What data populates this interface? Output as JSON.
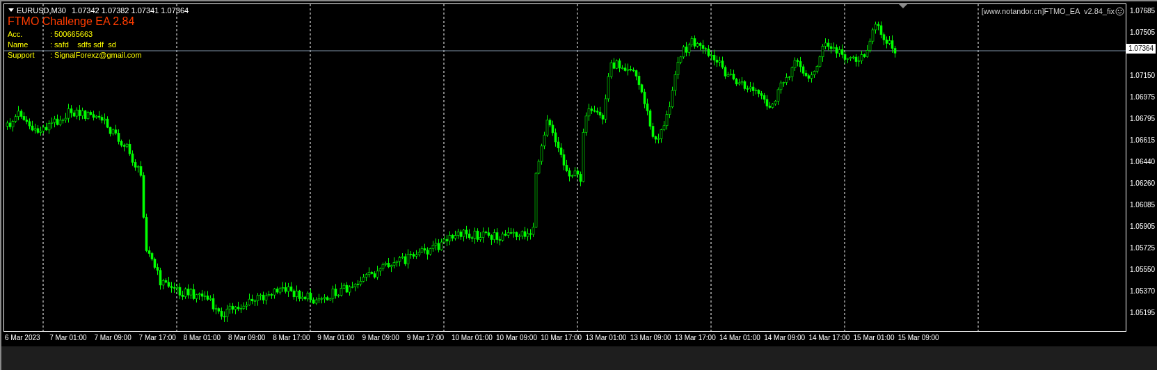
{
  "chart_header": {
    "symbol": "EURUSD,M30",
    "quotes": "1.07342 1.07382 1.07341 1.07364"
  },
  "ea_panel": {
    "title": "FTMO Challenge EA 2.84",
    "rows": [
      {
        "label": "Acc.",
        "value": ": 500665663"
      },
      {
        "label": "Name",
        "value": ": safd    sdfs sdf  sd"
      },
      {
        "label": "Support",
        "value": ": SignalForexz@gmail.com"
      }
    ]
  },
  "ea_badge": {
    "text": "[www.notandor.cn]FTMO_EA  v2.84_fix"
  },
  "price_scale": {
    "upper_ticks": [
      "1.07685",
      "1.07505"
    ],
    "current_price": "1.07364",
    "lower_ticks": [
      "1.07150",
      "1.06975",
      "1.06795",
      "1.06615",
      "1.06440",
      "1.06260",
      "1.06085",
      "1.05905",
      "1.05725",
      "1.05550",
      "1.05370",
      "1.05195"
    ]
  },
  "time_axis": [
    "6 Mar 2023",
    "7 Mar 01:00",
    "7 Mar 09:00",
    "7 Mar 17:00",
    "8 Mar 01:00",
    "8 Mar 09:00",
    "8 Mar 17:00",
    "9 Mar 01:00",
    "9 Mar 09:00",
    "9 Mar 17:00",
    "10 Mar 01:00",
    "10 Mar 09:00",
    "10 Mar 17:00",
    "13 Mar 01:00",
    "13 Mar 09:00",
    "13 Mar 17:00",
    "14 Mar 01:00",
    "14 Mar 09:00",
    "14 Mar 17:00",
    "15 Mar 01:00",
    "15 Mar 09:00"
  ]
}
